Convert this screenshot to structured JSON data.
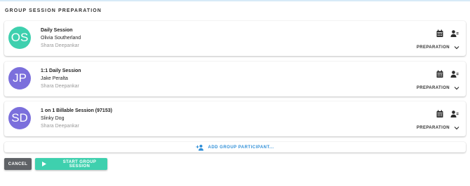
{
  "page_title": "GROUP SESSION PREPARATION",
  "sessions": [
    {
      "initials": "OS",
      "avatar_color": "#3ed0ae",
      "session_name": "Daily Session",
      "participant": "Olivia Southerland",
      "host": "Shara Deepankar",
      "prep_label": "PREPARATION"
    },
    {
      "initials": "JP",
      "avatar_color": "#7b6fdc",
      "session_name": "1:1 Daily Session",
      "participant": "Jake Peralta",
      "host": "Shara Deepankar",
      "prep_label": "PREPARATION"
    },
    {
      "initials": "SD",
      "avatar_color": "#7b6fdc",
      "session_name": "1 on 1 Billable Session (97153)",
      "participant": "Slinky Dog",
      "host": "Shara Deepankar",
      "prep_label": "PREPARATION"
    }
  ],
  "add_participant_label": "ADD GROUP PARTICIPANT...",
  "buttons": {
    "cancel": "CANCEL",
    "start": "START GROUP SESSION"
  },
  "icons": {
    "calendar": "calendar-icon",
    "person_edit": "person-edit-icon",
    "chevron": "chevron-down-icon",
    "add_person": "person-add-icon",
    "play": "play-icon"
  },
  "colors": {
    "accent": "#3ed0ae",
    "link": "#2f8fd8",
    "cancel": "#5f6266"
  }
}
